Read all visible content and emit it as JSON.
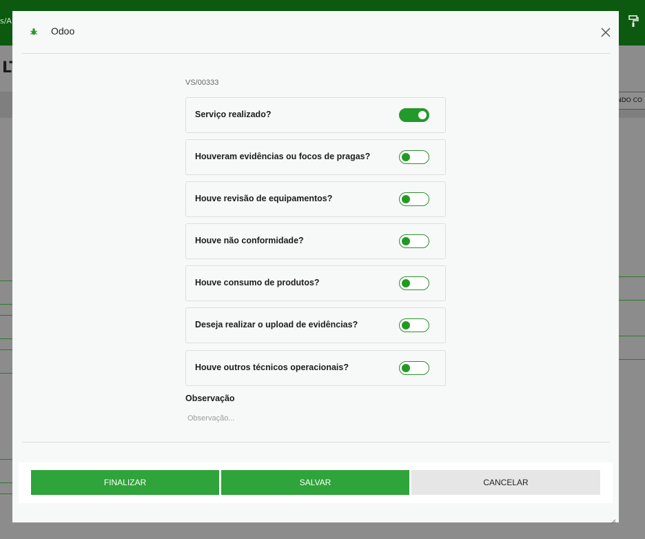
{
  "background": {
    "breadcrumb_fragment": "s/A",
    "title_fragment": "LT",
    "right_button_fragment": "NDO CO"
  },
  "modal": {
    "title": "Odoo",
    "reference": "VS/00333",
    "questions": [
      {
        "label": "Serviço realizado?",
        "checked": true
      },
      {
        "label": "Houveram evidências ou focos de pragas?",
        "checked": false
      },
      {
        "label": "Houve revisão de equipamentos?",
        "checked": false
      },
      {
        "label": "Houve não conformidade?",
        "checked": false
      },
      {
        "label": "Houve consumo de produtos?",
        "checked": false
      },
      {
        "label": "Deseja realizar o upload de evidências?",
        "checked": false
      },
      {
        "label": "Houve outros técnicos operacionais?",
        "checked": false
      }
    ],
    "observation": {
      "label": "Observação",
      "placeholder": "Observação...",
      "value": ""
    },
    "buttons": {
      "finalizar": "FINALIZAR",
      "salvar": "SALVAR",
      "cancelar": "CANCELAR"
    }
  },
  "colors": {
    "accent": "#2ea43a",
    "topbar": "#0b5a10",
    "toggle_on": "#22992a"
  },
  "icons": {
    "logo": "bug-icon",
    "close": "close-icon",
    "paint": "paint-roller-icon",
    "resize": "resize-grip-icon"
  }
}
